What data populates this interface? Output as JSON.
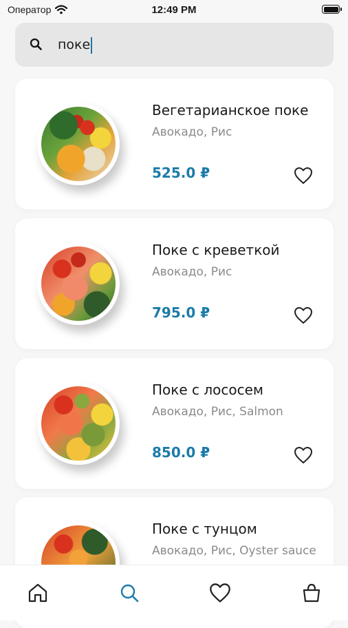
{
  "status_bar": {
    "carrier": "Оператор",
    "time": "12:49 PM"
  },
  "search": {
    "query": "поке"
  },
  "results": [
    {
      "name": "Вегетарианское поке",
      "ingredients": "Авокадо, Рис",
      "price": "525.0 ₽"
    },
    {
      "name": "Поке с креветкой",
      "ingredients": "Авокадо, Рис",
      "price": "795.0 ₽"
    },
    {
      "name": "Поке с лососем",
      "ingredients": "Авокадо, Рис, Salmon",
      "price": "850.0 ₽"
    },
    {
      "name": "Поке с тунцом",
      "ingredients": "Авокадо, Рис, Oyster sauce",
      "price": ""
    }
  ],
  "tab_bar": {
    "active": "search",
    "icons": [
      "home-icon",
      "search-icon",
      "heart-icon",
      "bag-icon"
    ]
  },
  "colors": {
    "accent": "#1b7ba8",
    "background": "#f7f7f7",
    "search_bg": "#e6e6e6"
  }
}
